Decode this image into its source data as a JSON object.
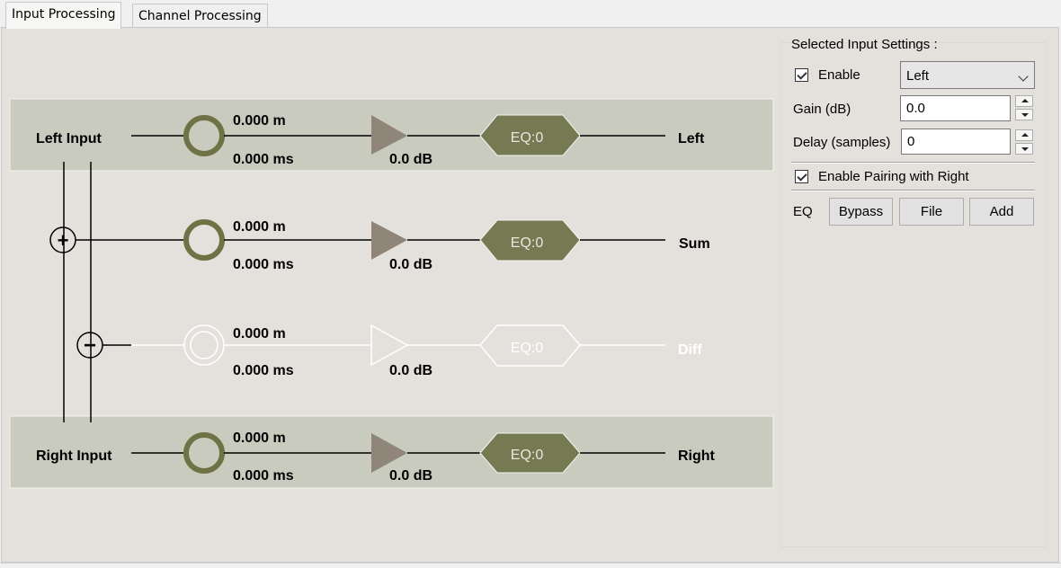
{
  "tabs": [
    {
      "label": "Input Processing",
      "active": true
    },
    {
      "label": "Channel Processing",
      "active": false
    }
  ],
  "colors": {
    "panel_bg": "#e4e1dc",
    "row_bg": "#c8cbbd",
    "olive": "#767a53",
    "gain_triangle": "#8f8578",
    "disabled": "#ffffff"
  },
  "diagram": {
    "rows": [
      {
        "input_label": "Left Input",
        "distance": "0.000 m",
        "delay": "0.000 ms",
        "gain": "0.0 dB",
        "eq": "EQ:0",
        "output_label": "Left",
        "enabled": true
      },
      {
        "input_label": "",
        "distance": "0.000 m",
        "delay": "0.000 ms",
        "gain": "0.0 dB",
        "eq": "EQ:0",
        "output_label": "Sum",
        "enabled": true
      },
      {
        "input_label": "",
        "distance": "0.000 m",
        "delay": "0.000 ms",
        "gain": "0.0 dB",
        "eq": "EQ:0",
        "output_label": "Diff",
        "enabled": false
      },
      {
        "input_label": "Right Input",
        "distance": "0.000 m",
        "delay": "0.000 ms",
        "gain": "0.0 dB",
        "eq": "EQ:0",
        "output_label": "Right",
        "enabled": true
      }
    ],
    "sum_symbol": "+",
    "diff_symbol": "−"
  },
  "settings": {
    "title": "Selected Input Settings :",
    "enable_label": "Enable",
    "enable_checked": true,
    "channel_selected": "Left",
    "gain_label": "Gain (dB)",
    "gain_value": "0.0",
    "delay_label": "Delay (samples)",
    "delay_value": "0",
    "pairing_label": "Enable Pairing with Right",
    "pairing_checked": true,
    "eq_label": "EQ",
    "bypass_label": "Bypass",
    "file_label": "File",
    "add_label": "Add"
  }
}
